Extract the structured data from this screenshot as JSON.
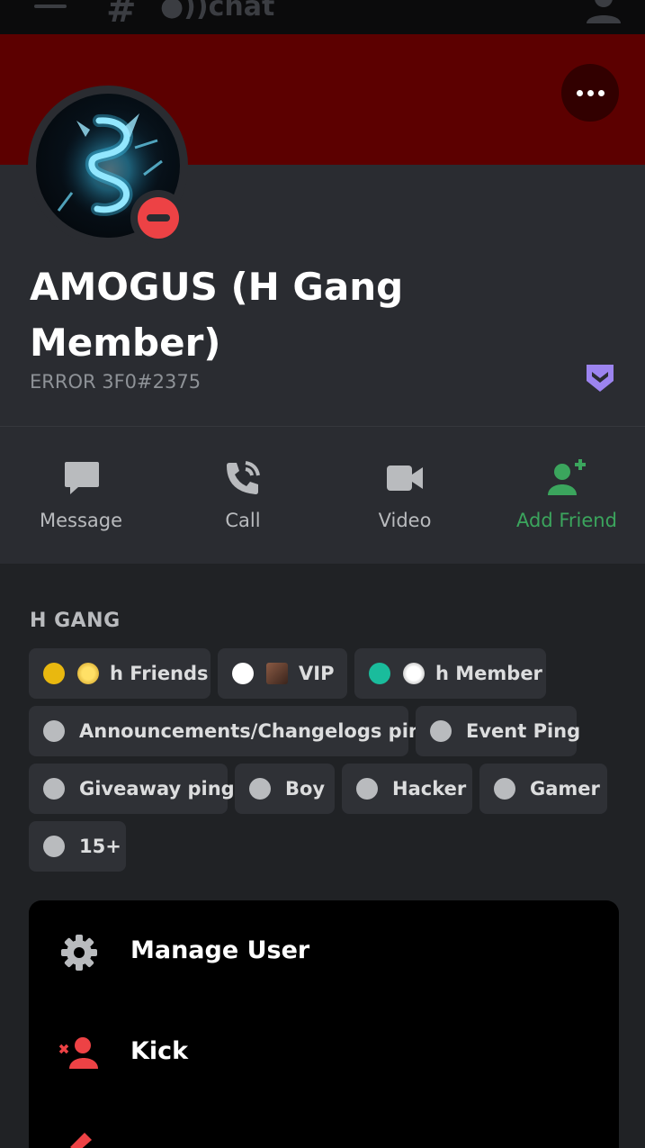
{
  "topbar": {
    "app_name": "chat"
  },
  "profile": {
    "name": "AMOGUS (H Gang Member)",
    "tag": "ERROR 3F0#2375",
    "status": "dnd",
    "status_color": "#ed4245",
    "banner_color": "#5c0000"
  },
  "actions": [
    {
      "label": "Message",
      "icon": "message-icon"
    },
    {
      "label": "Call",
      "icon": "phone-icon"
    },
    {
      "label": "Video",
      "icon": "video-icon"
    },
    {
      "label": "Add Friend",
      "icon": "add-friend-icon",
      "color": "#3ba55d"
    }
  ],
  "roles": {
    "section_title": "H GANG",
    "items": [
      {
        "label": "h Friends",
        "color": "#e9b80f"
      },
      {
        "label": "VIP",
        "color": "#ffffff"
      },
      {
        "label": "h Member",
        "color": "#1abc9c"
      },
      {
        "label": "Announcements/Changelogs ping",
        "color": "#b9bbbe"
      },
      {
        "label": "Event Ping",
        "color": "#b9bbbe"
      },
      {
        "label": "Giveaway ping",
        "color": "#b9bbbe"
      },
      {
        "label": "Boy",
        "color": "#b9bbbe"
      },
      {
        "label": "Hacker",
        "color": "#b9bbbe"
      },
      {
        "label": "Gamer",
        "color": "#b9bbbe"
      },
      {
        "label": "15+",
        "color": "#b9bbbe"
      }
    ]
  },
  "menu": {
    "manage_user": "Manage User",
    "kick": "Kick"
  }
}
